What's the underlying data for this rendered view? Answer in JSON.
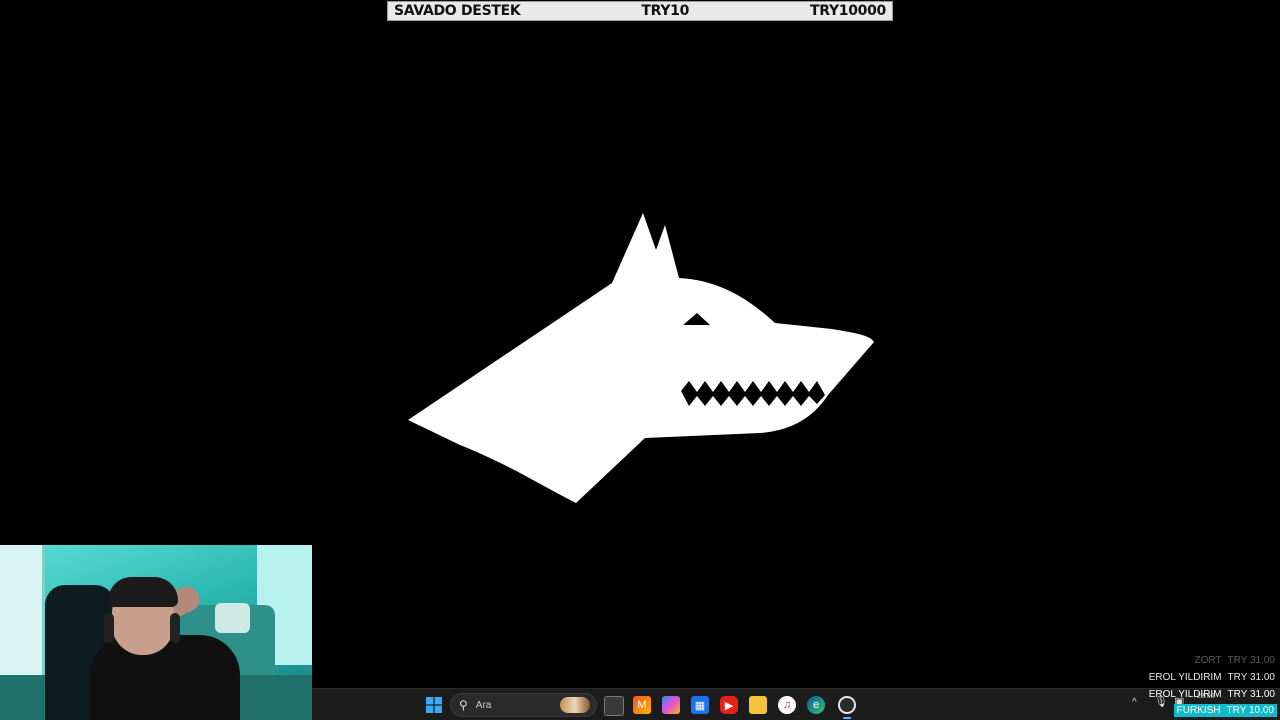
{
  "goal": {
    "title": "SAVADO DESTEK",
    "current": "TRY10",
    "target": "TRY10000"
  },
  "taskbar": {
    "search_placeholder": "Ara",
    "icons": [
      "windows-start-icon",
      "search-icon",
      "file-explorer-window-icon",
      "office-icon",
      "copilot-icon",
      "store-icon",
      "youtube-icon",
      "folder-icon",
      "itunes-icon",
      "edge-icon",
      "obs-icon"
    ]
  },
  "tray": {
    "clock": "23:00"
  },
  "donations": [
    {
      "name": "ZORT",
      "amount": "TRY 31.00"
    },
    {
      "name": "EROL YILDIRIM",
      "amount": "TRY 31.00"
    },
    {
      "name": "EROL YILDIRIM",
      "amount": "TRY 31.00"
    },
    {
      "name": "FURKISH",
      "amount": "TRY 10.00"
    }
  ],
  "colors": {
    "background": "#000000",
    "logo": "#ffffff",
    "highlight": "#14b9c9"
  }
}
